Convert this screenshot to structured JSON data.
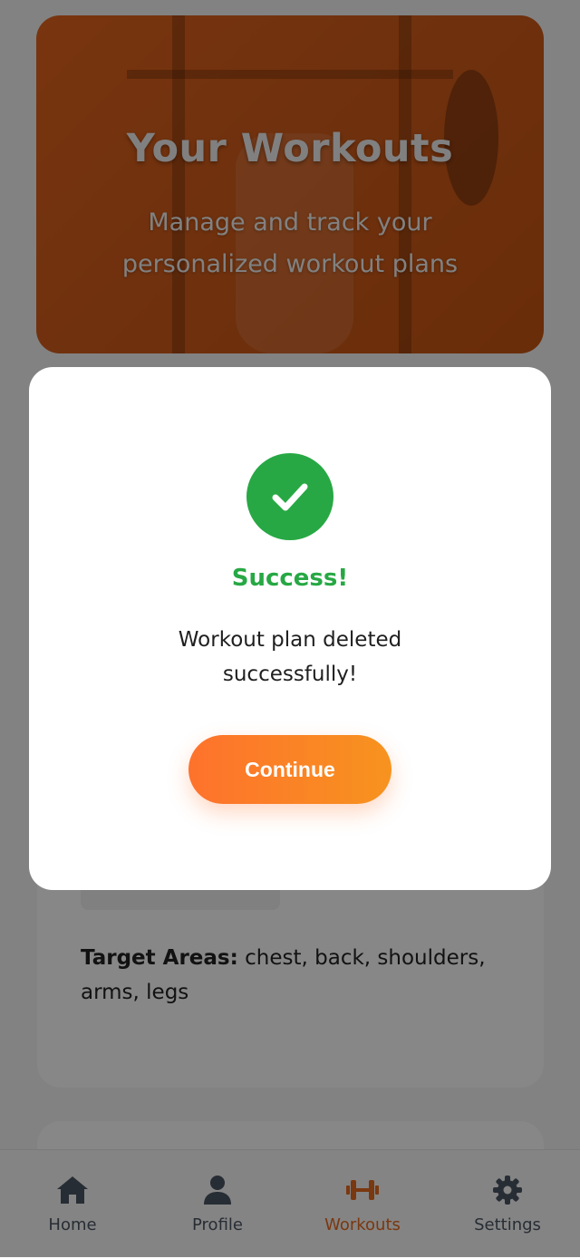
{
  "hero": {
    "title": "Your Workouts",
    "subtitle": "Manage and track your personalized workout plans"
  },
  "card": {
    "target_label": "Target Areas:",
    "target_value": "chest, back, shoulders, arms, legs"
  },
  "modal": {
    "icon": "check-icon",
    "title": "Success!",
    "message": "Workout plan deleted successfully!",
    "button_label": "Continue"
  },
  "bottom_nav": {
    "items": [
      {
        "label": "Home",
        "icon": "home-icon"
      },
      {
        "label": "Profile",
        "icon": "user-icon"
      },
      {
        "label": "Workouts",
        "icon": "dumbbell-icon"
      },
      {
        "label": "Settings",
        "icon": "gear-icon"
      }
    ],
    "active": "Workouts"
  },
  "colors": {
    "accent": "#e66a1f",
    "success": "#27a844",
    "button_gradient_start": "#fe722c",
    "button_gradient_end": "#f7931f"
  }
}
